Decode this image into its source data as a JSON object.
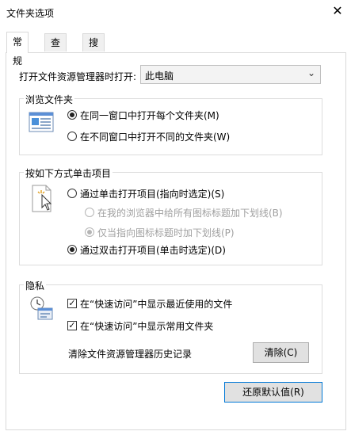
{
  "window": {
    "title": "文件夹选项",
    "close_glyph": "✕"
  },
  "tabs": [
    {
      "label": "常规",
      "active": true
    },
    {
      "label": "查看",
      "active": false
    },
    {
      "label": "搜索",
      "active": false
    }
  ],
  "open_explorer": {
    "label": "打开文件资源管理器时打开:",
    "selected": "此电脑"
  },
  "browse_folders": {
    "title": "浏览文件夹",
    "options": [
      {
        "label": "在同一窗口中打开每个文件夹(M)",
        "selected": true
      },
      {
        "label": "在不同窗口中打开不同的文件夹(W)",
        "selected": false
      }
    ]
  },
  "click_items": {
    "title": "按如下方式单击项目",
    "options": [
      {
        "label": "通过单击打开项目(指向时选定)(S)",
        "selected": false,
        "enabled": true
      },
      {
        "label": "在我的浏览器中给所有图标标题加下划线(B)",
        "selected": false,
        "enabled": false
      },
      {
        "label": "仅当指向图标标题时加下划线(P)",
        "selected": true,
        "enabled": false
      },
      {
        "label": "通过双击打开项目(单击时选定)(D)",
        "selected": true,
        "enabled": true
      }
    ]
  },
  "privacy": {
    "title": "隐私",
    "checks": [
      {
        "label": "在“快速访问”中显示最近使用的文件",
        "checked": true
      },
      {
        "label": "在“快速访问”中显示常用文件夹",
        "checked": true
      }
    ],
    "clear_label": "清除文件资源管理器历史记录",
    "clear_button": "清除(C)"
  },
  "restore_button": "还原默认值(R)",
  "icons": {
    "check_glyph": "✓",
    "dropdown_glyph": "⌄"
  }
}
